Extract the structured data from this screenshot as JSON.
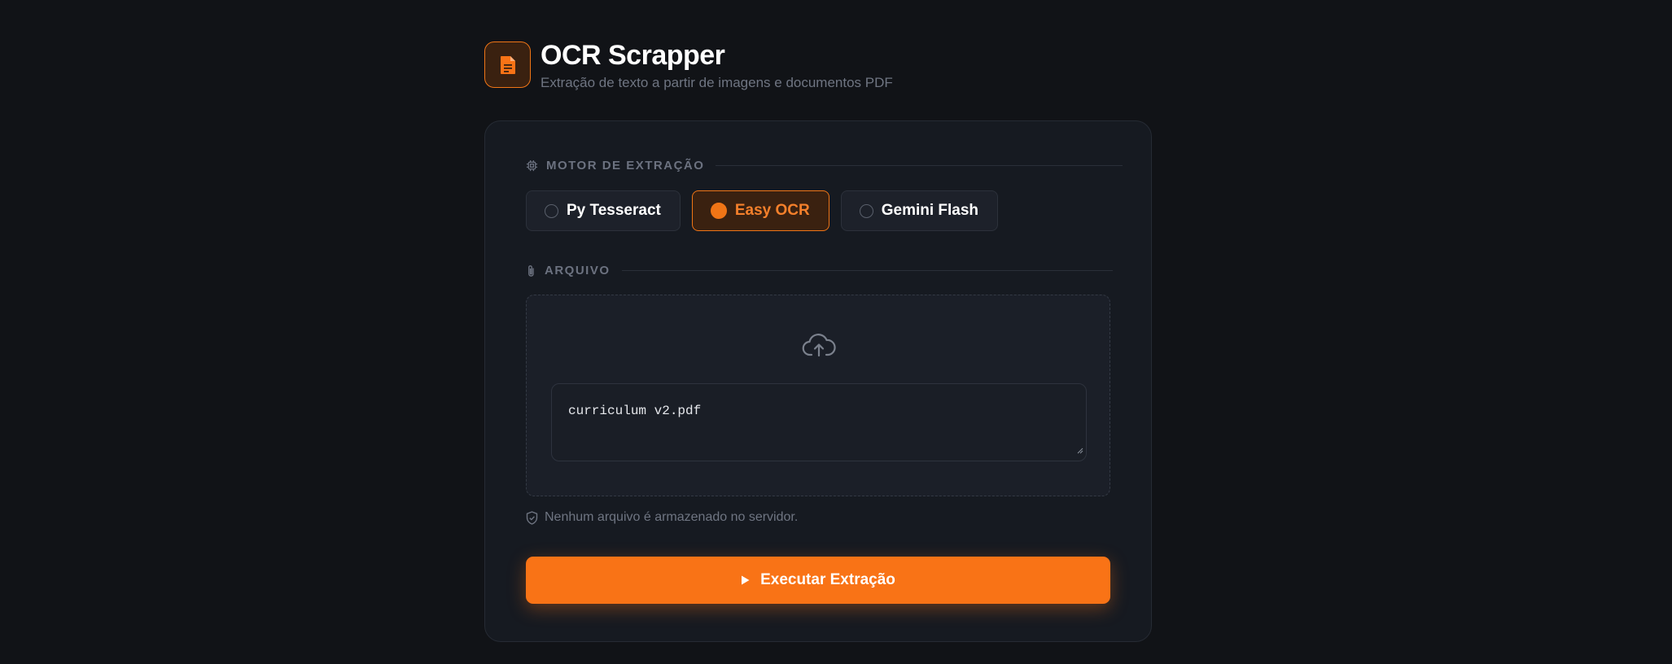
{
  "app": {
    "title": "OCR Scrapper",
    "subtitle": "Extração de texto a partir de imagens e documentos PDF"
  },
  "engine_section": {
    "label": "MOTOR DE EXTRAÇÃO",
    "options": [
      {
        "label": "Py Tesseract",
        "selected": false
      },
      {
        "label": "Easy OCR",
        "selected": true
      },
      {
        "label": "Gemini Flash",
        "selected": false
      }
    ]
  },
  "file_section": {
    "label": "ARQUIVO",
    "upload_icon": "cloud-upload-icon",
    "file_value": "curriculum v2.pdf",
    "notice": "Nenhum arquivo é armazenado no servidor."
  },
  "run_button": {
    "label": "Executar Extração",
    "icon": "play-icon"
  },
  "colors": {
    "accent": "#f97316",
    "background": "#111317",
    "card": "#161a21"
  }
}
